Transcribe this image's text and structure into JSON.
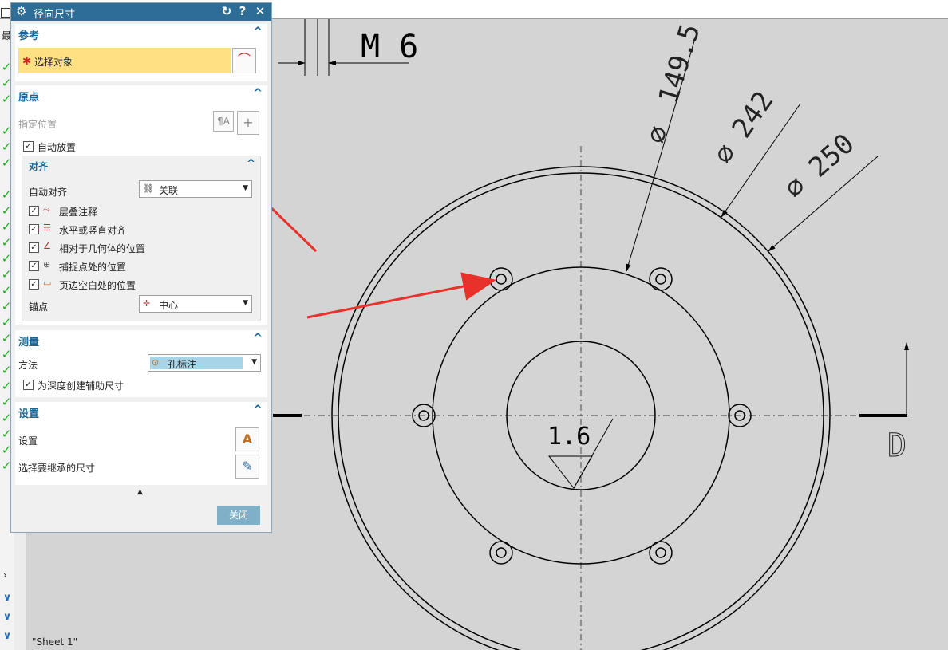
{
  "dialog": {
    "title": "径向尺寸",
    "sections": {
      "reference": {
        "header": "参考",
        "select_object": "选择对象"
      },
      "origin": {
        "header": "原点",
        "specify_location": "指定位置",
        "auto_place": "自动放置",
        "align": {
          "header": "对齐",
          "auto_align_label": "自动对齐",
          "auto_align_value": "关联",
          "options": [
            "层叠注释",
            "水平或竖直对齐",
            "相对于几何体的位置",
            "捕捉点处的位置",
            "页边空白处的位置"
          ],
          "anchor_label": "锚点",
          "anchor_value": "中心"
        }
      },
      "measure": {
        "header": "测量",
        "method_label": "方法",
        "method_value": "孔标注",
        "aux_dim": "为深度创建辅助尺寸"
      },
      "settings": {
        "header": "设置",
        "settings_label": "设置",
        "inherit_label": "选择要继承的尺寸"
      }
    },
    "close_label": "关闭"
  },
  "left_strip": {
    "top_char": "最"
  },
  "drawing": {
    "thread_label": "M 6",
    "dims": [
      "149.5",
      "242",
      "250"
    ],
    "diameter_symbol": "∅",
    "roughness": "1.6",
    "section_letter": "D",
    "sheet_name": "\"Sheet 1\""
  },
  "colors": {
    "accent": "#2e6e96",
    "highlight": "#ffe083",
    "arrow": "#e8312a"
  }
}
